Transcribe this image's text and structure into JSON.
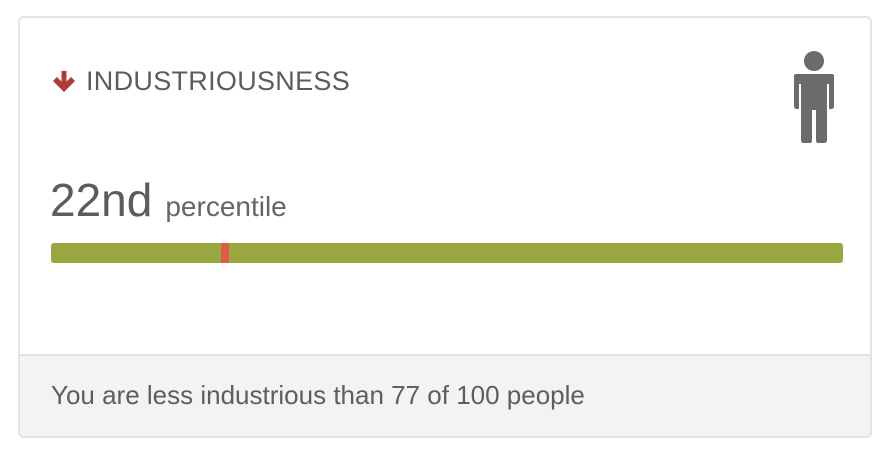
{
  "trait": {
    "name": "INDUSTRIOUSNESS",
    "trend_icon": "arrow-down-icon",
    "trend_color": "#b03a3a",
    "profile_icon": "person-icon"
  },
  "percentile": {
    "value": "22nd",
    "label": "percentile",
    "fraction": 0.22
  },
  "bar": {
    "track_color": "#9aa63e",
    "marker_color": "#e05a4c"
  },
  "footer": {
    "text": "You are less industrious than 77 of 100 people"
  }
}
